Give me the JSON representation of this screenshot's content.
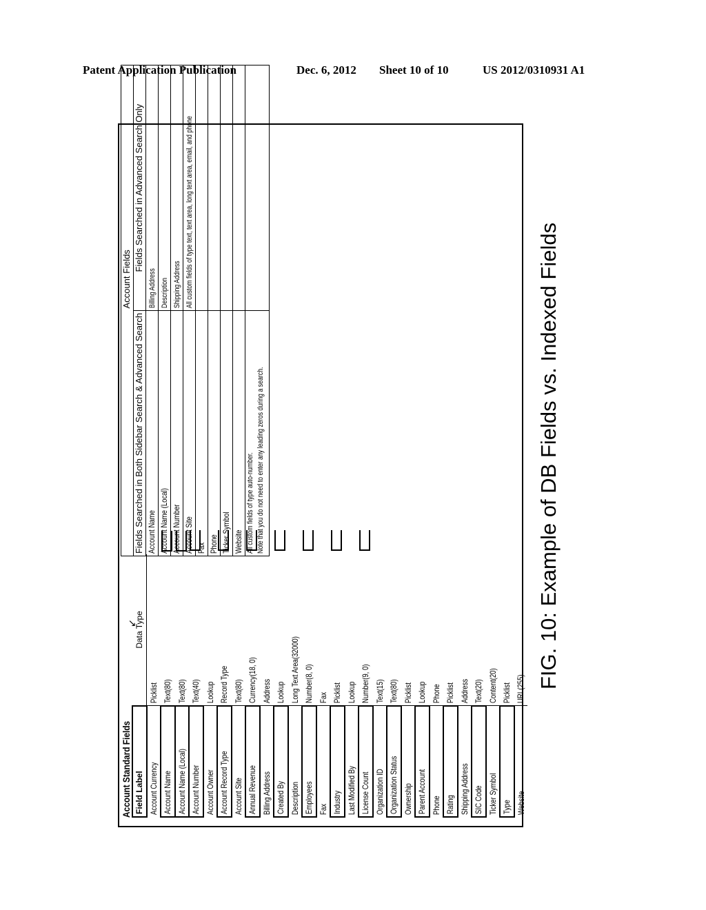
{
  "header": {
    "publication": "Patent Application Publication",
    "date": "Dec. 6, 2012",
    "sheet": "Sheet 10 of 10",
    "number": "US 2012/0310931 A1"
  },
  "standard_fields": {
    "title": "Account Standard Fields",
    "columns": [
      "Field Label",
      "Data Type"
    ],
    "rows": [
      {
        "label": "Account Currency",
        "type": "Picklist",
        "boxed": false
      },
      {
        "label": "Account Name",
        "type": "Text(80)",
        "boxed": true
      },
      {
        "label": "Account Name (Local)",
        "type": "Text(80)",
        "boxed": true
      },
      {
        "label": "Account Number",
        "type": "Text(40)",
        "boxed": true
      },
      {
        "label": "Account Owner",
        "type": "Lookup",
        "boxed": false
      },
      {
        "label": "Account Record Type",
        "type": "Record Type",
        "boxed": true
      },
      {
        "label": "Account Site",
        "type": "Text(80)",
        "boxed": false
      },
      {
        "label": "Annual Revenue",
        "type": "Currency(18, 0)",
        "boxed": true
      },
      {
        "label": "Billing Address",
        "type": "Address",
        "boxed": false
      },
      {
        "label": "Created By",
        "type": "Lookup",
        "boxed": true
      },
      {
        "label": "Description",
        "type": "Long Text Area(32000)",
        "boxed": false
      },
      {
        "label": "Employees",
        "type": "Number(8, 0)",
        "boxed": true
      },
      {
        "label": "Fax",
        "type": "Fax",
        "boxed": false
      },
      {
        "label": "Industry",
        "type": "Picklist",
        "boxed": true
      },
      {
        "label": "Last Modified By",
        "type": "Lookup",
        "boxed": false
      },
      {
        "label": "License Count",
        "type": "Number(9, 0)",
        "boxed": true
      },
      {
        "label": "Organization ID",
        "type": "Text(15)",
        "boxed": false
      },
      {
        "label": "Organization Status",
        "type": "Text(80)",
        "boxed": true
      },
      {
        "label": "Ownership",
        "type": "Picklist",
        "boxed": false
      },
      {
        "label": "Parent Account",
        "type": "Lookup",
        "boxed": true
      },
      {
        "label": "Phone",
        "type": "Phone",
        "boxed": false
      },
      {
        "label": "Rating",
        "type": "Picklist",
        "boxed": true
      },
      {
        "label": "Shipping Address",
        "type": "Address",
        "boxed": false
      },
      {
        "label": "SIC Code",
        "type": "Text(20)",
        "boxed": true
      },
      {
        "label": "Ticker Symbol",
        "type": "Content(20)",
        "boxed": false
      },
      {
        "label": "Type",
        "type": "Picklist",
        "boxed": true
      },
      {
        "label": "Website",
        "type": "URL(255)",
        "boxed": false
      }
    ]
  },
  "account_fields": {
    "group_title": "Account Fields",
    "col_a": "Fields Searched in Both Sidebar Search & Advanced Search",
    "col_b": "Fields Searched in Advanced Search Only",
    "rows": [
      {
        "a": "Account Name",
        "b": "Billing Address"
      },
      {
        "a": "Account Name (Local)",
        "b": "Description"
      },
      {
        "a": "Account Number",
        "b": "Shipping Address"
      },
      {
        "a": "Account Site",
        "b": "All custom fields of type text, text area, long text area, email, and phone"
      },
      {
        "a": "Fax",
        "b": ""
      },
      {
        "a": "Phone",
        "b": ""
      },
      {
        "a": "Ticker Symbol",
        "b": ""
      },
      {
        "a": "Website",
        "b": ""
      }
    ],
    "note_line1": "All custom fields of type auto-number.",
    "note_line2": "Note that you do not need to enter any leading zeros during a search."
  },
  "caption": "FIG. 10: Example of DB Fields vs. Indexed Fields"
}
